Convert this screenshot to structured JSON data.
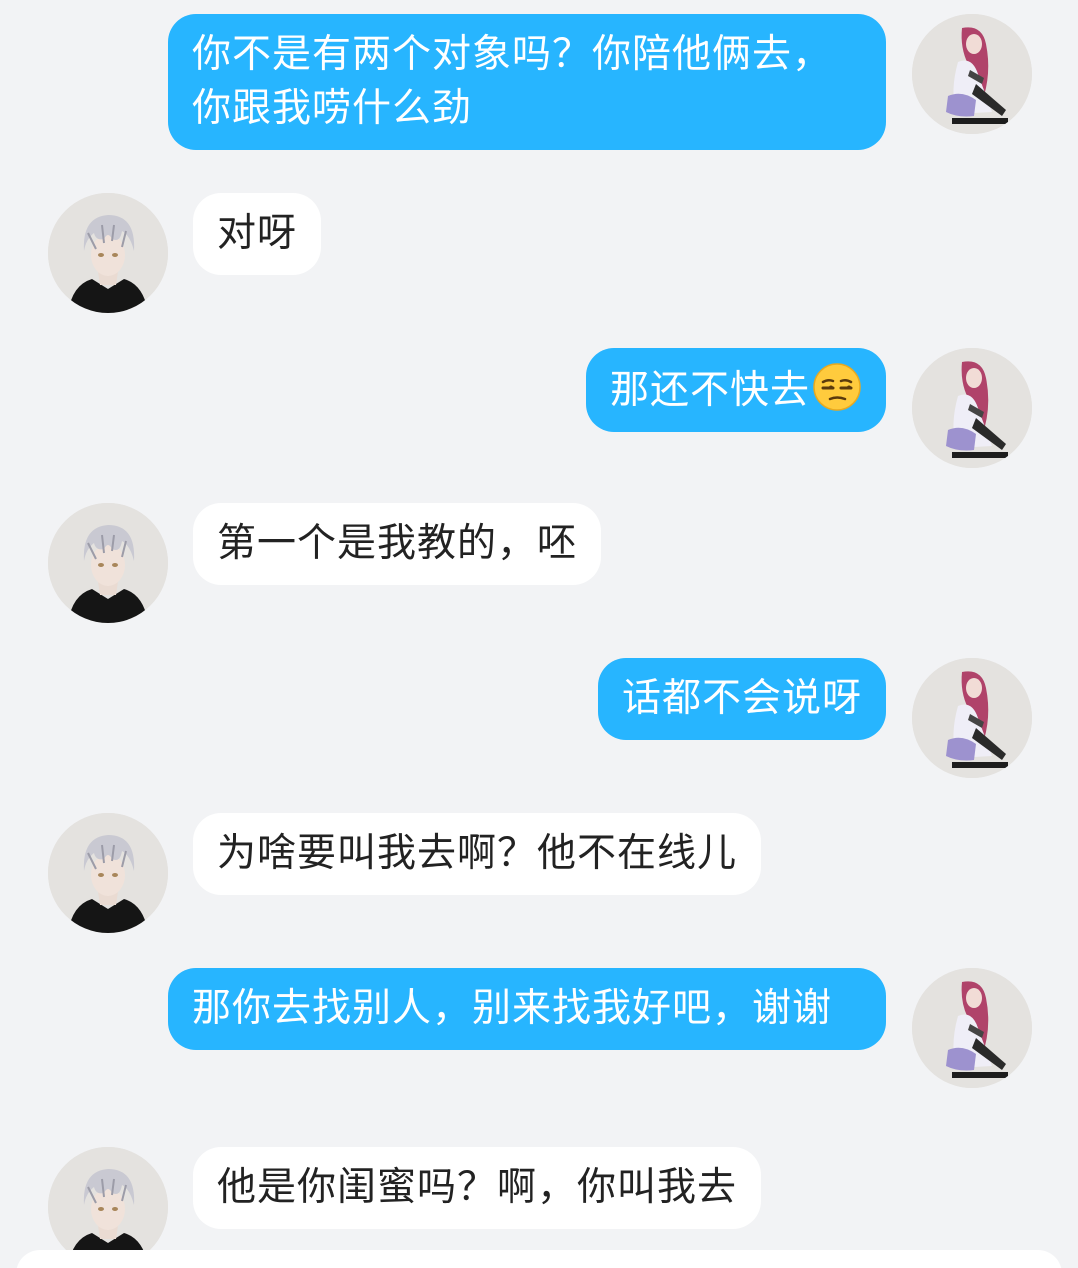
{
  "colors": {
    "background": "#f2f3f5",
    "outgoing_bubble": "#27b5ff",
    "incoming_bubble": "#ffffff",
    "outgoing_text": "#ffffff",
    "incoming_text": "#222222"
  },
  "messages": [
    {
      "side": "out",
      "text": "你不是有两个对象吗？你陪他俩去，你跟我唠什么劲",
      "avatar": "female-avatar"
    },
    {
      "side": "in",
      "text": "对呀",
      "avatar": "male-avatar"
    },
    {
      "side": "out",
      "text": "那还不快去",
      "emoji": "unamused-face-emoji",
      "avatar": "female-avatar"
    },
    {
      "side": "in",
      "text": "第一个是我教的，呸",
      "avatar": "male-avatar"
    },
    {
      "side": "out",
      "text": "话都不会说呀",
      "avatar": "female-avatar"
    },
    {
      "side": "in",
      "text": "为啥要叫我去啊？他不在线儿",
      "avatar": "male-avatar"
    },
    {
      "side": "out",
      "text": "那你去找别人，别来找我好吧，谢谢",
      "avatar": "female-avatar"
    },
    {
      "side": "in",
      "text": "他是你闺蜜吗？啊，你叫我去",
      "avatar": "male-avatar"
    }
  ]
}
